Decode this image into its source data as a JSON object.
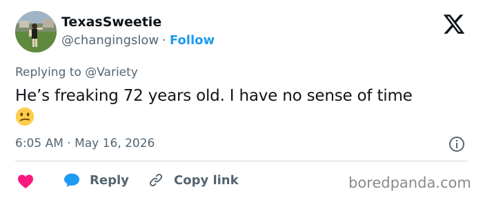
{
  "user": {
    "display_name": "TexasSweetie",
    "handle": "@changingslow",
    "separator": "·",
    "follow_label": "Follow"
  },
  "platform_logo": {
    "icon": "x-logo-icon"
  },
  "tweet": {
    "replying_to": "Replying to @Variety",
    "text": "He’s freaking 72 years old. I have no sense of time",
    "emoji": "confused-face-emoji",
    "timestamp": "6:05 AM · May 16, 2026"
  },
  "actions": {
    "like_icon": "heart-icon",
    "reply_label": "Reply",
    "copy_link_label": "Copy link"
  },
  "watermark": "boredpanda.com",
  "colors": {
    "accent": "#1d9bf0",
    "like": "#f91880",
    "secondary_text": "#536471",
    "divider": "#cfd9de"
  }
}
